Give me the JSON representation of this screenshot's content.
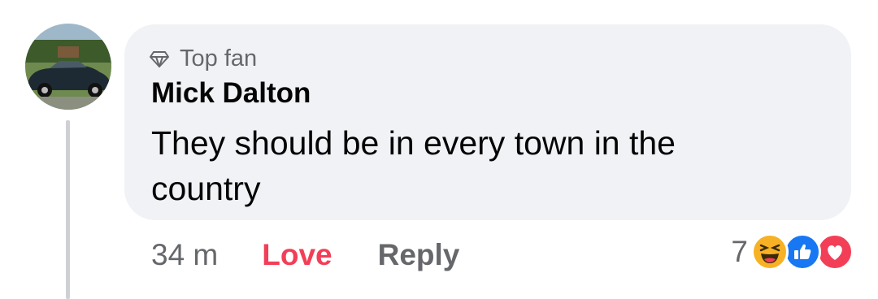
{
  "comment": {
    "badge": "Top fan",
    "author": "Mick Dalton",
    "text": "They should be in every town in the country",
    "avatar_icon": "avatar-classic-car-photo"
  },
  "actions": {
    "time": "34 m",
    "love_label": "Love",
    "reply_label": "Reply"
  },
  "reactions": {
    "count": "7",
    "icons": [
      "haha-icon",
      "like-icon",
      "love-icon"
    ]
  },
  "colors": {
    "love": "#f33e58",
    "like": "#1877f2",
    "haha": "#f7b125",
    "bubble": "#f0f2f5",
    "secondary_text": "#65676b"
  }
}
